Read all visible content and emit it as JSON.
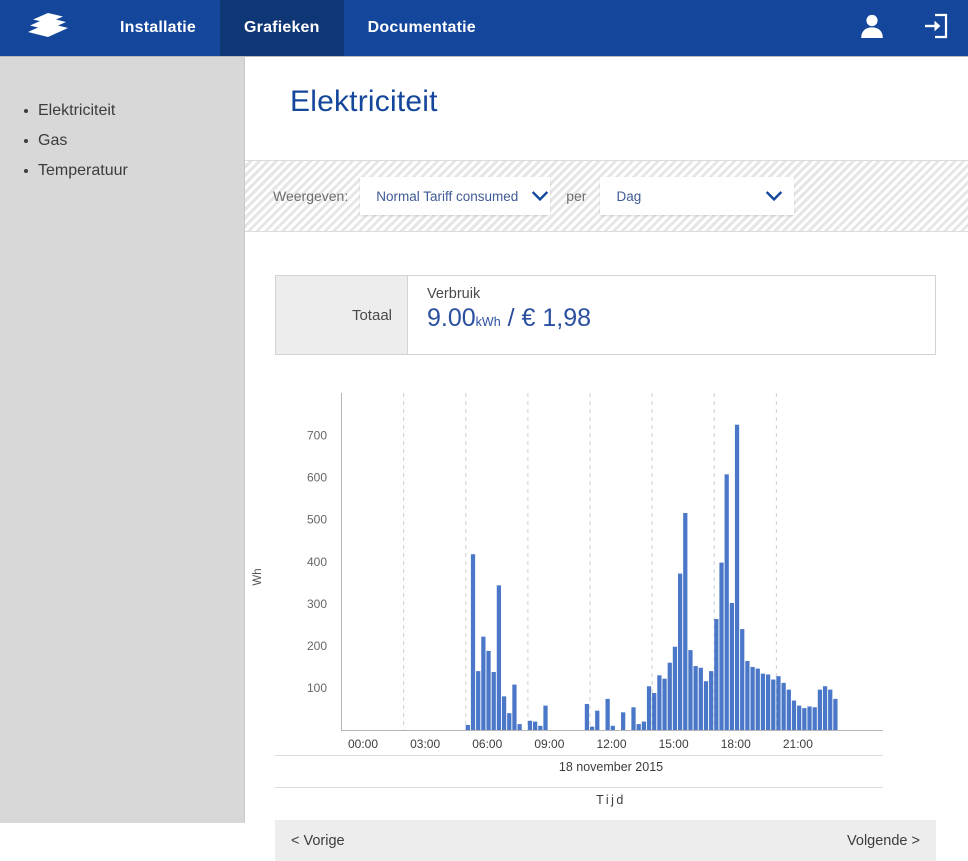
{
  "nav": {
    "logo_icon": "waves-logo-icon",
    "tabs": [
      {
        "label": "Installatie",
        "active": false
      },
      {
        "label": "Grafieken",
        "active": true
      },
      {
        "label": "Documentatie",
        "active": false
      }
    ],
    "user_icon": "user-icon",
    "logout_icon": "logout-icon"
  },
  "sidebar": {
    "items": [
      {
        "label": "Elektriciteit"
      },
      {
        "label": "Gas"
      },
      {
        "label": "Temperatuur"
      }
    ]
  },
  "page": {
    "title": "Elektriciteit"
  },
  "filter": {
    "weergeven_label": "Weergeven:",
    "metric_value": "Normal Tariff consumed",
    "per_label": "per",
    "period_value": "Dag",
    "chevron_icon": "chevron-down-icon"
  },
  "totals": {
    "row_label": "Totaal",
    "metric_label": "Verbruik",
    "energy_value": "9.00",
    "energy_unit": "kWh",
    "separator": "/",
    "cost_value": "€ 1,98"
  },
  "footer": {
    "prev_label": "< Vorige",
    "next_label": "Volgende >"
  },
  "colors": {
    "nav_blue": "#14479b",
    "nav_active_blue": "#0f3675",
    "bar_blue": "#4a77c8",
    "title_blue": "#14479b",
    "value_blue": "#2a4fa0",
    "sidebar_gray": "#d8d8d8"
  },
  "chart_data": {
    "type": "bar",
    "title": "",
    "xlabel": "Tijd",
    "ylabel": "Wh",
    "subtitle": "18 november 2015",
    "ylim": [
      0,
      780
    ],
    "yticks": [
      100,
      200,
      300,
      400,
      500,
      600,
      700
    ],
    "xtick_labels": [
      "00:00",
      "03:00",
      "06:00",
      "09:00",
      "12:00",
      "15:00",
      "18:00",
      "21:00"
    ],
    "xtick_hours": [
      0,
      3,
      6,
      9,
      12,
      15,
      18,
      21
    ],
    "grid": "vertical-dashed",
    "legend": "none",
    "bin_minutes": 15,
    "x_start_hour": 0,
    "x_end_hour": 24,
    "values": [
      0,
      0,
      0,
      0,
      0,
      0,
      0,
      0,
      0,
      0,
      0,
      0,
      0,
      0,
      0,
      0,
      0,
      0,
      0,
      0,
      0,
      0,
      0,
      0,
      12,
      418,
      140,
      222,
      188,
      138,
      344,
      80,
      40,
      108,
      14,
      0,
      22,
      20,
      10,
      58,
      0,
      0,
      0,
      0,
      0,
      0,
      0,
      62,
      8,
      46,
      0,
      74,
      10,
      0,
      42,
      0,
      54,
      14,
      20,
      104,
      88,
      130,
      122,
      160,
      198,
      372,
      516,
      190,
      152,
      148,
      116,
      140,
      264,
      398,
      608,
      302,
      726,
      240,
      164,
      150,
      146,
      134,
      132,
      120,
      128,
      112,
      96,
      70,
      58,
      52,
      56,
      54,
      96,
      104,
      96,
      74
    ]
  }
}
